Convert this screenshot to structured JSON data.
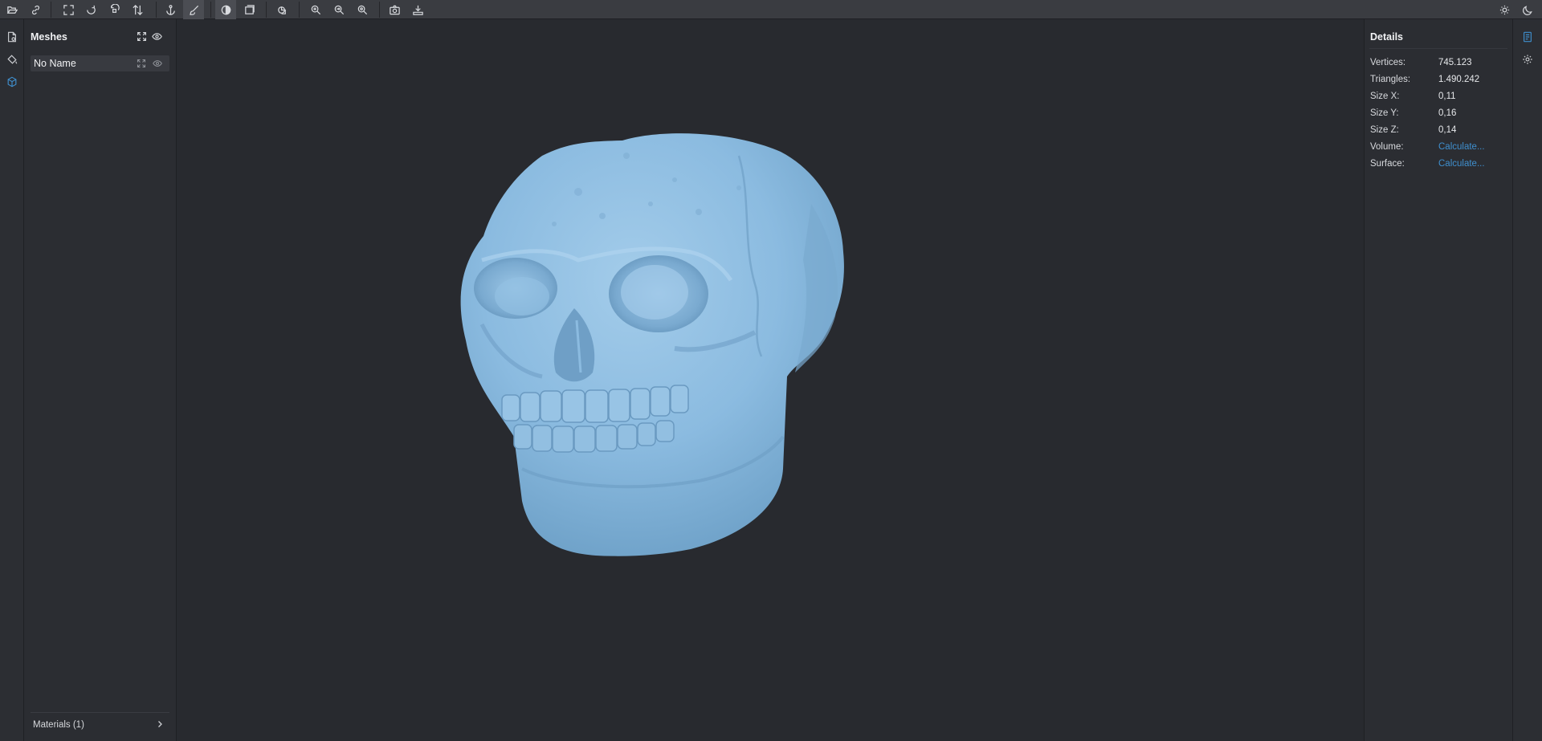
{
  "toolbar": {
    "left_buttons": [
      "open-file-icon",
      "link-icon",
      "fit-view-icon",
      "rotate-icon",
      "rotate-alt-icon",
      "flip-icon",
      "anchor-icon",
      "brush-icon",
      "shading-icon",
      "layers-icon",
      "measure-icon",
      "zoom-add-icon",
      "zoom-move-icon",
      "zoom-settings-icon",
      "camera-icon",
      "export-icon"
    ],
    "right_buttons": [
      "sun-icon",
      "moon-icon"
    ]
  },
  "left_rail": {
    "items": [
      "document-icon",
      "paint-bucket-icon",
      "cube-icon"
    ],
    "active": "cube-icon"
  },
  "meshes_panel": {
    "title": "Meshes",
    "items": [
      {
        "label": "No Name"
      }
    ],
    "materials_label": "Materials (1)"
  },
  "details": {
    "title": "Details",
    "rows": [
      {
        "key": "Vertices:",
        "value": "745.123",
        "link": false
      },
      {
        "key": "Triangles:",
        "value": "1.490.242",
        "link": false
      },
      {
        "key": "Size X:",
        "value": "0,11",
        "link": false
      },
      {
        "key": "Size Y:",
        "value": "0,16",
        "link": false
      },
      {
        "key": "Size Z:",
        "value": "0,14",
        "link": false
      },
      {
        "key": "Volume:",
        "value": "Calculate...",
        "link": true
      },
      {
        "key": "Surface:",
        "value": "Calculate...",
        "link": true
      }
    ]
  },
  "right_rail": {
    "items": [
      "details-icon",
      "settings-gear-icon"
    ],
    "active": "details-icon"
  },
  "colors": {
    "background": "#282a2f",
    "toolbar": "#3a3c41",
    "panel": "#2b2d32",
    "accent": "#3f8fce",
    "mesh": "#86b9de"
  }
}
